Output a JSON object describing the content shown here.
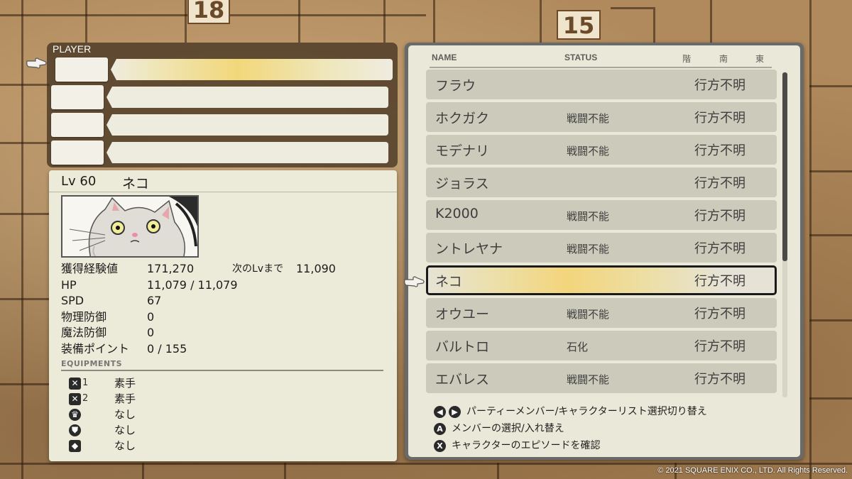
{
  "player_panel": {
    "title": "PLAYER",
    "slots": 4,
    "active_slot": 0
  },
  "character": {
    "level": "Lv 60",
    "name": "ネコ",
    "stats": [
      {
        "label": "獲得経験値",
        "value": "171,270",
        "extra_label": "次のLvまで",
        "extra_value": "11,090"
      },
      {
        "label": "HP",
        "value": "11,079 / 11,079"
      },
      {
        "label": "SPD",
        "value": "67"
      },
      {
        "label": "物理防御",
        "value": "0"
      },
      {
        "label": "魔法防御",
        "value": "0"
      },
      {
        "label": "装備ポイント",
        "value": "0 / 155"
      }
    ],
    "equipments_title": "EQUIPMENTS",
    "equipments": [
      {
        "icon": "sword-icon",
        "slot_num": "1",
        "value": "素手"
      },
      {
        "icon": "sword-icon",
        "slot_num": "2",
        "value": "素手"
      },
      {
        "icon": "crown-icon",
        "slot_num": "",
        "value": "なし"
      },
      {
        "icon": "armor-icon",
        "slot_num": "",
        "value": "なし"
      },
      {
        "icon": "shield-icon",
        "slot_num": "",
        "value": "なし"
      }
    ]
  },
  "list": {
    "headers": {
      "name": "NAME",
      "status": "STATUS",
      "col1": "階",
      "col2": "南",
      "col3": "東"
    },
    "rows": [
      {
        "name": "フラウ",
        "status": "",
        "location": "行方不明"
      },
      {
        "name": "ホクガク",
        "status": "戦闘不能",
        "location": "行方不明"
      },
      {
        "name": "モデナリ",
        "status": "戦闘不能",
        "location": "行方不明"
      },
      {
        "name": "ジョラス",
        "status": "",
        "location": "行方不明"
      },
      {
        "name": "K2000",
        "status": "戦闘不能",
        "location": "行方不明"
      },
      {
        "name": "ントレヤナ",
        "status": "戦闘不能",
        "location": "行方不明"
      },
      {
        "name": "ネコ",
        "status": "",
        "location": "行方不明"
      },
      {
        "name": "オウユー",
        "status": "戦闘不能",
        "location": "行方不明"
      },
      {
        "name": "バルトロ",
        "status": "石化",
        "location": "行方不明"
      },
      {
        "name": "エバレス",
        "status": "戦闘不能",
        "location": "行方不明"
      }
    ],
    "selected_index": 6,
    "scroll_fraction": 0.58
  },
  "help": [
    {
      "buttons": "◀▶",
      "text": "パーティーメンバー/キャラクターリスト選択切り替え"
    },
    {
      "buttons": "A",
      "text": "メンバーの選択/入れ替え"
    },
    {
      "buttons": "X",
      "text": "キャラクターのエピソードを確認"
    }
  ],
  "board_numbers": [
    "18",
    "15"
  ],
  "copyright": "© 2021 SQUARE ENIX CO., LTD. All Rights Reserved.",
  "colors": {
    "highlight": "#f3d57c",
    "panel": "#eae8d8",
    "row": "#cbcabb"
  }
}
